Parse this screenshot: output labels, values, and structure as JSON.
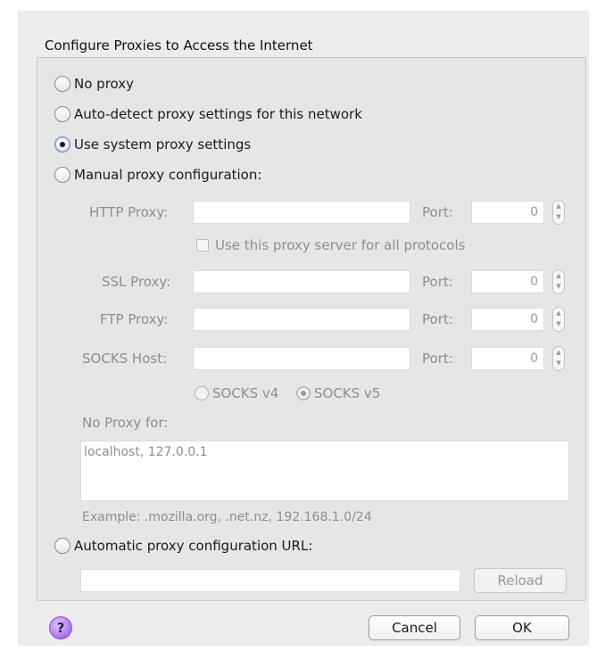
{
  "dialog": {
    "title": "Configure Proxies to Access the Internet",
    "options": {
      "no_proxy": "No proxy",
      "auto_detect": "Auto-detect proxy settings for this network",
      "system": "Use system proxy settings",
      "manual": "Manual proxy configuration:",
      "auto_url": "Automatic proxy configuration URL:"
    },
    "selected_option": "system",
    "manual": {
      "http_label": "HTTP Proxy:",
      "ssl_label": "SSL Proxy:",
      "ftp_label": "FTP Proxy:",
      "socks_label": "SOCKS Host:",
      "port_label": "Port:",
      "http_port": "0",
      "ssl_port": "0",
      "ftp_port": "0",
      "socks_port": "0",
      "share_label": "Use this proxy server for all protocols",
      "socks_v4": "SOCKS v4",
      "socks_v5": "SOCKS v5",
      "socks_selected": "v5"
    },
    "no_proxy": {
      "label": "No Proxy for:",
      "value": "localhost, 127.0.0.1",
      "example": "Example: .mozilla.org, .net.nz, 192.168.1.0/24"
    },
    "buttons": {
      "reload": "Reload",
      "cancel": "Cancel",
      "ok": "OK",
      "help": "?"
    }
  }
}
